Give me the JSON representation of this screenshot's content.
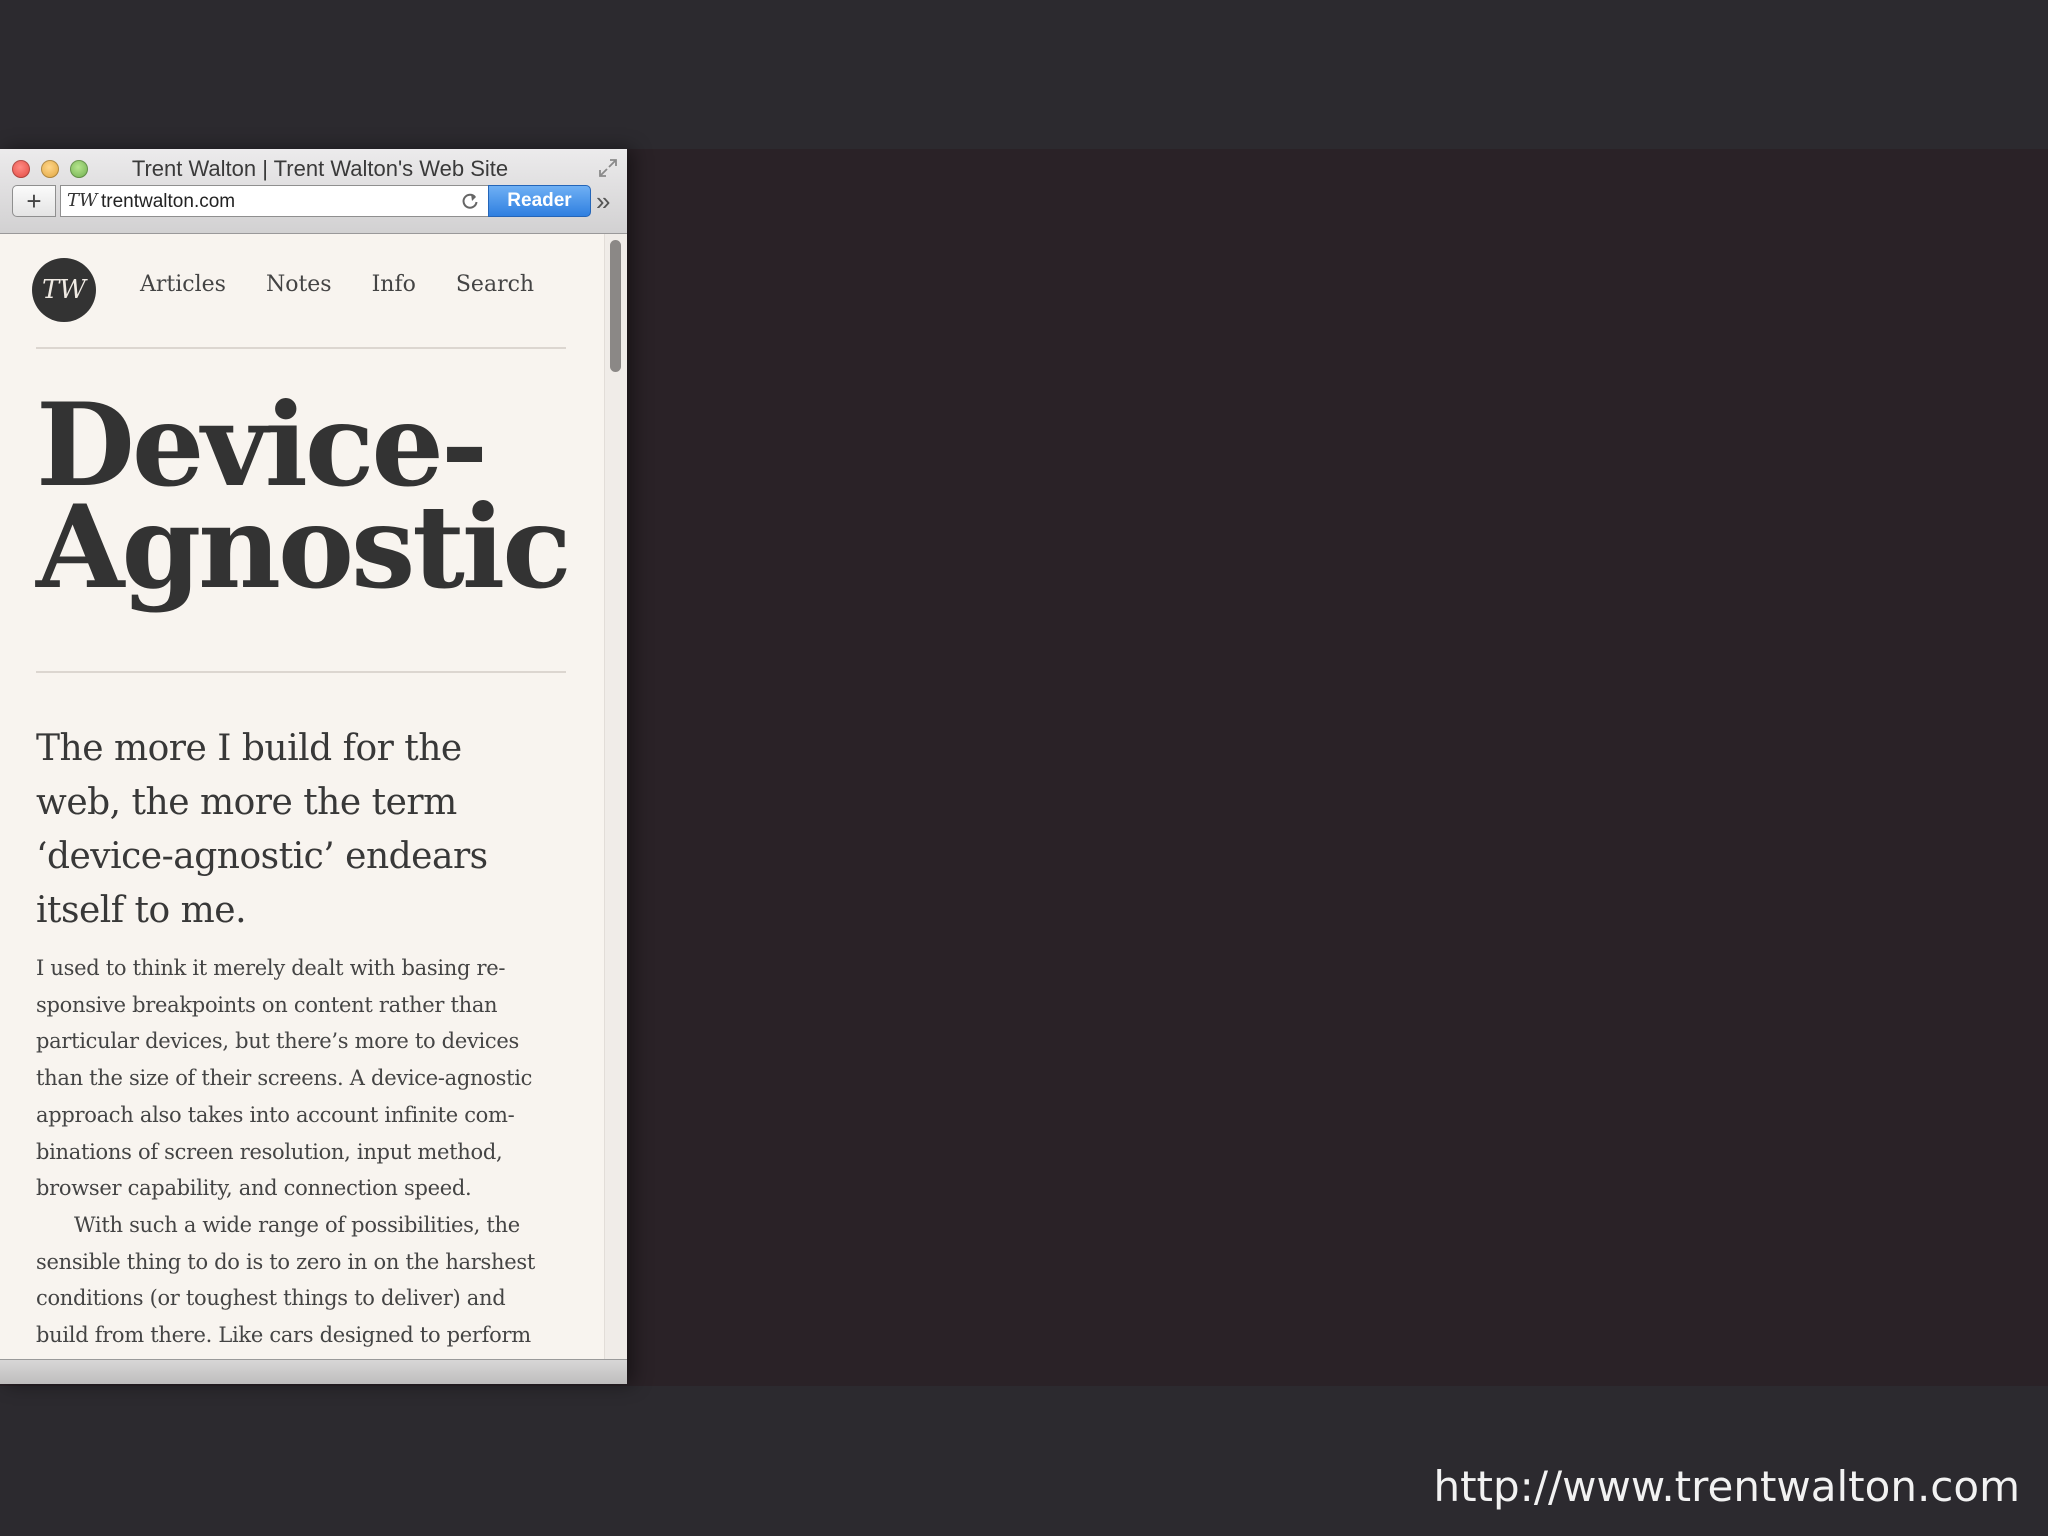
{
  "browser": {
    "window_title": "Trent Walton | Trent Walton's Web Site",
    "add_label": "+",
    "favicon_text": "TW",
    "url": "trentwalton.com",
    "reader_label": "Reader",
    "overflow_label": "»"
  },
  "site": {
    "logo_text": "TW",
    "nav": [
      "Articles",
      "Notes",
      "Info",
      "Search"
    ],
    "headline_line1": "Device-",
    "headline_line2": "Agnostic",
    "intro_lines": [
      "The more I build for the",
      "web, the more the term",
      "‘device-agnostic’ endears",
      "itself to me."
    ],
    "body_lines": [
      "I used to think it merely dealt with basing re-",
      "sponsive breakpoints on content rather than",
      "particular devices, but there’s more to devices",
      "than the size of their screens. A device-agnostic",
      "approach also takes into account infinite com-",
      "binations of screen resolution, input method,",
      "browser capability, and connection speed."
    ],
    "body2_lines": [
      "With such a wide range of possibilities, the",
      "sensible thing to do is to zero in on the harshest",
      "conditions (or toughest things to deliver) and",
      "build from there. Like cars designed to perform"
    ]
  },
  "caption": "http://www.trentwalton.com",
  "colors": {
    "background": "#2c2a2f",
    "desktop": "#2a2227",
    "page": "#f8f4ef",
    "reader_button": "#3a86e6"
  }
}
